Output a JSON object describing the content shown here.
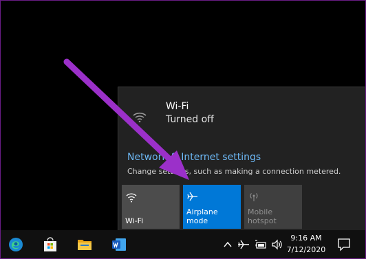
{
  "flyout": {
    "wifi_name": "Wi-Fi",
    "wifi_state": "Turned off",
    "network_link": "Network & Internet settings",
    "network_desc": "Change settings, such as making a connection metered."
  },
  "tiles": [
    {
      "label": "Wi-Fi",
      "icon": "wifi-icon",
      "state": "off"
    },
    {
      "label": "Airplane mode",
      "icon": "airplane-icon",
      "state": "on"
    },
    {
      "label": "Mobile hotspot",
      "icon": "hotspot-icon",
      "state": "disabled"
    }
  ],
  "taskbar": {
    "apps": [
      "edge-icon",
      "store-icon",
      "file-explorer-icon",
      "word-icon"
    ],
    "time": "9:16 AM",
    "date": "7/12/2020"
  },
  "colors": {
    "accent": "#0078d7",
    "link": "#6db8f5",
    "annotation_arrow": "#9b30c9"
  }
}
